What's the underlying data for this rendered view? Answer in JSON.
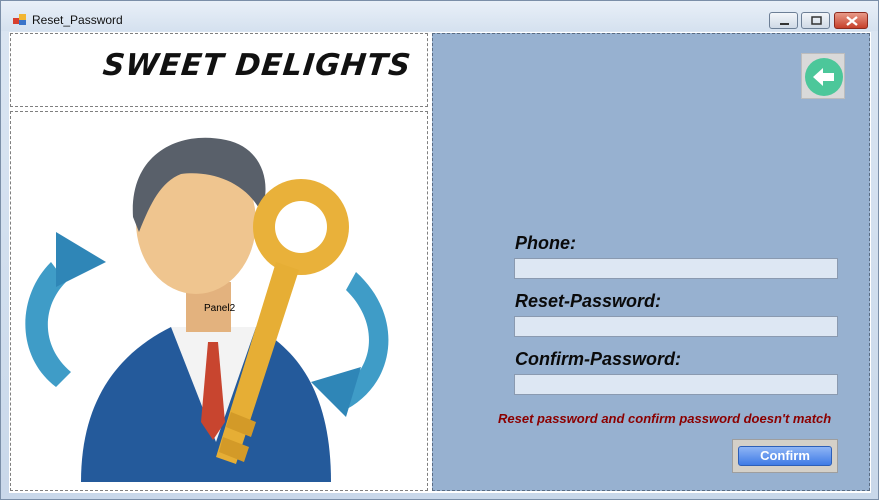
{
  "window": {
    "title": "Reset_Password",
    "controls": [
      "minimize-icon",
      "maximize-icon",
      "close-icon"
    ]
  },
  "logo": {
    "text": "SWEET DELIGHTS"
  },
  "image_panel": {
    "label": "Panel2",
    "illustration": "user-key-reset-icon"
  },
  "form": {
    "back_icon": "back-arrow-icon",
    "phone_label": "Phone:",
    "phone_value": "",
    "reset_label": "Reset-Password:",
    "reset_value": "",
    "confirm_label": "Confirm-Password:",
    "confirm_value": "",
    "error_message": "Reset password and confirm password doesn't match",
    "confirm_button": "Confirm"
  },
  "colors": {
    "form_panel": "#97b1d0",
    "error": "#8b0000",
    "button": "#3f7be6",
    "back_arrow": "#4cc79a"
  }
}
